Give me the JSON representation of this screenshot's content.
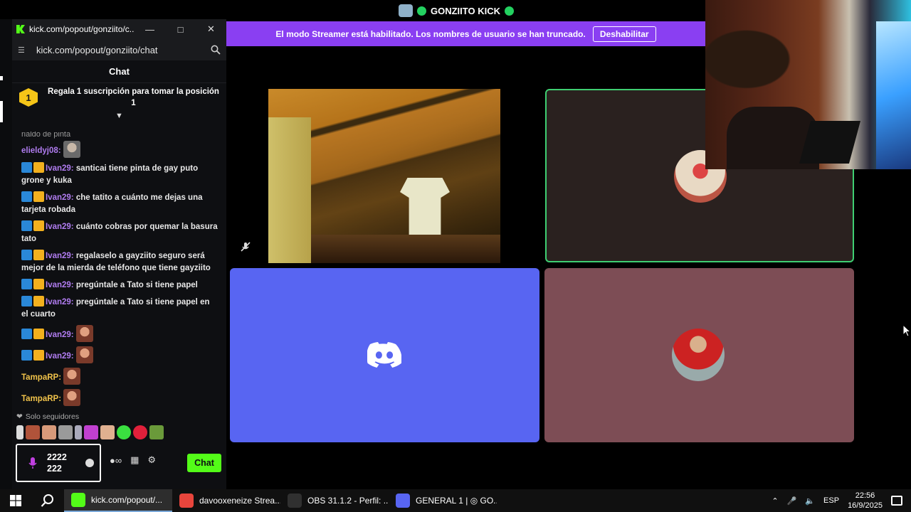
{
  "stage": {
    "title": "GONZIITO KICK",
    "banner_text": "El modo Streamer está habilitado. Los nombres de usuario se han truncado.",
    "banner_button": "Deshabilitar"
  },
  "chat_window": {
    "titlebar": "kick.com/popout/gonziito/c...",
    "url": "kick.com/popout/gonziito/chat",
    "header": "Chat",
    "promo_rank": "1",
    "promo_text": "Regala 1 suscripción para tomar la posición 1",
    "partial_top": "rialdo de pinta",
    "messages": [
      {
        "user": "elieldyj08:",
        "text": "",
        "badges": false,
        "emote": true,
        "gold": false
      },
      {
        "user": "Ivan29:",
        "text": " santicai tiene pinta de gay puto grone y kuka",
        "badges": true,
        "emote": false,
        "gold": false
      },
      {
        "user": "Ivan29:",
        "text": " che tatito a cuánto me dejas una tarjeta robada",
        "badges": true,
        "emote": false,
        "gold": false
      },
      {
        "user": "Ivan29:",
        "text": " cuánto cobras por quemar la basura tato",
        "badges": true,
        "emote": false,
        "gold": false
      },
      {
        "user": "Ivan29:",
        "text": " regalaselo a gayziito seguro será mejor de la mierda de teléfono que tiene gayziito",
        "badges": true,
        "emote": false,
        "gold": false
      },
      {
        "user": "Ivan29:",
        "text": " pregúntale a Tato si tiene papel",
        "badges": true,
        "emote": false,
        "gold": false
      },
      {
        "user": "Ivan29:",
        "text": " pregúntale a Tato si tiene papel en el cuarto",
        "badges": true,
        "emote": false,
        "gold": false
      },
      {
        "user": "Ivan29:",
        "text": "",
        "badges": true,
        "emote": true,
        "gold": false
      },
      {
        "user": "Ivan29:",
        "text": "",
        "badges": true,
        "emote": true,
        "gold": false
      },
      {
        "user": "TampaRP:",
        "text": "",
        "badges": false,
        "emote": true,
        "gold": true
      },
      {
        "user": "TampaRP:",
        "text": "",
        "badges": false,
        "emote": true,
        "gold": true
      }
    ],
    "followers_label": "Solo seguidores",
    "input_value": "2222\n222",
    "send_label": "Chat"
  },
  "taskbar": {
    "items": [
      {
        "label": "kick.com/popout/...",
        "color": "#53fc18",
        "active": true
      },
      {
        "label": "davooxeneize Strea...",
        "color": "#e8453c",
        "active": false
      },
      {
        "label": "OBS 31.1.2 - Perfil: ...",
        "color": "#303030",
        "active": false
      },
      {
        "label": "GENERAL 1 | ◎ GO...",
        "color": "#5865f2",
        "active": false
      }
    ],
    "lang": "ESP",
    "time": "22:56",
    "date": "16/9/2025"
  },
  "colors": {
    "kick_green": "#53fc18",
    "discord_blurple": "#5865f2",
    "banner_purple": "#8a3ff2",
    "speaking_border": "#3fcf72"
  }
}
